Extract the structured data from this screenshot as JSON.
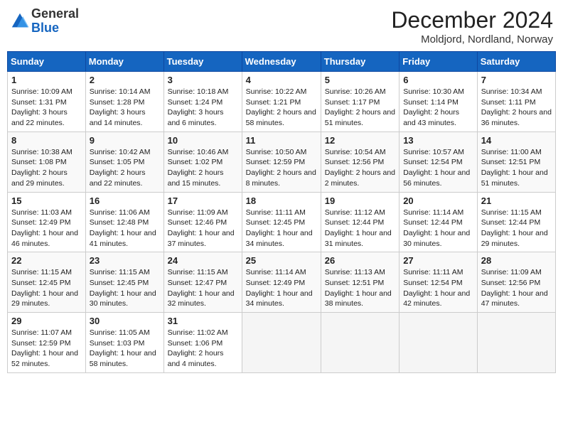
{
  "logo": {
    "general": "General",
    "blue": "Blue"
  },
  "title": "December 2024",
  "location": "Moldjord, Nordland, Norway",
  "days_of_week": [
    "Sunday",
    "Monday",
    "Tuesday",
    "Wednesday",
    "Thursday",
    "Friday",
    "Saturday"
  ],
  "weeks": [
    [
      {
        "day": "1",
        "info": "Sunrise: 10:09 AM\nSunset: 1:31 PM\nDaylight: 3 hours and 22 minutes."
      },
      {
        "day": "2",
        "info": "Sunrise: 10:14 AM\nSunset: 1:28 PM\nDaylight: 3 hours and 14 minutes."
      },
      {
        "day": "3",
        "info": "Sunrise: 10:18 AM\nSunset: 1:24 PM\nDaylight: 3 hours and 6 minutes."
      },
      {
        "day": "4",
        "info": "Sunrise: 10:22 AM\nSunset: 1:21 PM\nDaylight: 2 hours and 58 minutes."
      },
      {
        "day": "5",
        "info": "Sunrise: 10:26 AM\nSunset: 1:17 PM\nDaylight: 2 hours and 51 minutes."
      },
      {
        "day": "6",
        "info": "Sunrise: 10:30 AM\nSunset: 1:14 PM\nDaylight: 2 hours and 43 minutes."
      },
      {
        "day": "7",
        "info": "Sunrise: 10:34 AM\nSunset: 1:11 PM\nDaylight: 2 hours and 36 minutes."
      }
    ],
    [
      {
        "day": "8",
        "info": "Sunrise: 10:38 AM\nSunset: 1:08 PM\nDaylight: 2 hours and 29 minutes."
      },
      {
        "day": "9",
        "info": "Sunrise: 10:42 AM\nSunset: 1:05 PM\nDaylight: 2 hours and 22 minutes."
      },
      {
        "day": "10",
        "info": "Sunrise: 10:46 AM\nSunset: 1:02 PM\nDaylight: 2 hours and 15 minutes."
      },
      {
        "day": "11",
        "info": "Sunrise: 10:50 AM\nSunset: 12:59 PM\nDaylight: 2 hours and 8 minutes."
      },
      {
        "day": "12",
        "info": "Sunrise: 10:54 AM\nSunset: 12:56 PM\nDaylight: 2 hours and 2 minutes."
      },
      {
        "day": "13",
        "info": "Sunrise: 10:57 AM\nSunset: 12:54 PM\nDaylight: 1 hour and 56 minutes."
      },
      {
        "day": "14",
        "info": "Sunrise: 11:00 AM\nSunset: 12:51 PM\nDaylight: 1 hour and 51 minutes."
      }
    ],
    [
      {
        "day": "15",
        "info": "Sunrise: 11:03 AM\nSunset: 12:49 PM\nDaylight: 1 hour and 46 minutes."
      },
      {
        "day": "16",
        "info": "Sunrise: 11:06 AM\nSunset: 12:48 PM\nDaylight: 1 hour and 41 minutes."
      },
      {
        "day": "17",
        "info": "Sunrise: 11:09 AM\nSunset: 12:46 PM\nDaylight: 1 hour and 37 minutes."
      },
      {
        "day": "18",
        "info": "Sunrise: 11:11 AM\nSunset: 12:45 PM\nDaylight: 1 hour and 34 minutes."
      },
      {
        "day": "19",
        "info": "Sunrise: 11:12 AM\nSunset: 12:44 PM\nDaylight: 1 hour and 31 minutes."
      },
      {
        "day": "20",
        "info": "Sunrise: 11:14 AM\nSunset: 12:44 PM\nDaylight: 1 hour and 30 minutes."
      },
      {
        "day": "21",
        "info": "Sunrise: 11:15 AM\nSunset: 12:44 PM\nDaylight: 1 hour and 29 minutes."
      }
    ],
    [
      {
        "day": "22",
        "info": "Sunrise: 11:15 AM\nSunset: 12:45 PM\nDaylight: 1 hour and 29 minutes."
      },
      {
        "day": "23",
        "info": "Sunrise: 11:15 AM\nSunset: 12:45 PM\nDaylight: 1 hour and 30 minutes."
      },
      {
        "day": "24",
        "info": "Sunrise: 11:15 AM\nSunset: 12:47 PM\nDaylight: 1 hour and 32 minutes."
      },
      {
        "day": "25",
        "info": "Sunrise: 11:14 AM\nSunset: 12:49 PM\nDaylight: 1 hour and 34 minutes."
      },
      {
        "day": "26",
        "info": "Sunrise: 11:13 AM\nSunset: 12:51 PM\nDaylight: 1 hour and 38 minutes."
      },
      {
        "day": "27",
        "info": "Sunrise: 11:11 AM\nSunset: 12:54 PM\nDaylight: 1 hour and 42 minutes."
      },
      {
        "day": "28",
        "info": "Sunrise: 11:09 AM\nSunset: 12:56 PM\nDaylight: 1 hour and 47 minutes."
      }
    ],
    [
      {
        "day": "29",
        "info": "Sunrise: 11:07 AM\nSunset: 12:59 PM\nDaylight: 1 hour and 52 minutes."
      },
      {
        "day": "30",
        "info": "Sunrise: 11:05 AM\nSunset: 1:03 PM\nDaylight: 1 hour and 58 minutes."
      },
      {
        "day": "31",
        "info": "Sunrise: 11:02 AM\nSunset: 1:06 PM\nDaylight: 2 hours and 4 minutes."
      },
      null,
      null,
      null,
      null
    ]
  ]
}
